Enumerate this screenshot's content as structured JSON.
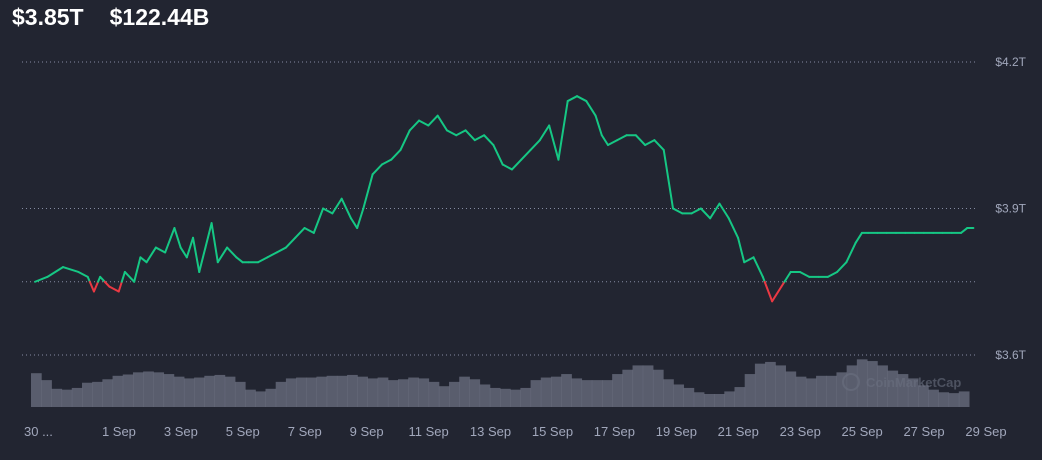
{
  "header": {
    "market_cap": "$3.85T",
    "volume": "$122.44B"
  },
  "watermark": "CoinMarketCap",
  "chart_data": {
    "type": "line",
    "title": "",
    "y_axis": {
      "position": "right",
      "ticks": [
        {
          "value": 3.6,
          "label": "$3.6T"
        },
        {
          "value": 3.9,
          "label": "$3.9T"
        },
        {
          "value": 4.2,
          "label": "$4.2T"
        }
      ],
      "ylim": [
        3.5,
        4.3
      ],
      "baseline": 3.75,
      "grid": "dotted"
    },
    "x_axis": {
      "xlim": [
        0,
        30.5
      ],
      "ticks": [
        {
          "value": 0,
          "label": "30 ..."
        },
        {
          "value": 2,
          "label": "1 Sep"
        },
        {
          "value": 4,
          "label": "3 Sep"
        },
        {
          "value": 6,
          "label": "5 Sep"
        },
        {
          "value": 8,
          "label": "7 Sep"
        },
        {
          "value": 10,
          "label": "9 Sep"
        },
        {
          "value": 12,
          "label": "11 Sep"
        },
        {
          "value": 14,
          "label": "13 Sep"
        },
        {
          "value": 16,
          "label": "15 Sep"
        },
        {
          "value": 18,
          "label": "17 Sep"
        },
        {
          "value": 20,
          "label": "19 Sep"
        },
        {
          "value": 22,
          "label": "21 Sep"
        },
        {
          "value": 24,
          "label": "23 Sep"
        },
        {
          "value": 26,
          "label": "25 Sep"
        },
        {
          "value": 28,
          "label": "27 Sep"
        },
        {
          "value": 30,
          "label": "29 Sep"
        }
      ]
    },
    "series": [
      {
        "values_x": [
          0.1,
          0.5,
          1.0,
          1.5,
          1.8,
          2.0,
          2.2,
          2.5,
          2.8,
          3.0,
          3.3,
          3.5,
          3.7,
          4.0,
          4.3,
          4.6,
          4.8,
          5.0,
          5.2,
          5.4,
          5.6,
          5.8,
          6.0,
          6.3,
          6.6,
          6.8,
          7.0,
          7.3,
          7.6,
          7.9,
          8.2,
          8.5,
          8.8,
          9.1,
          9.4,
          9.7,
          10.0,
          10.3,
          10.5,
          10.7,
          11.0,
          11.3,
          11.6,
          11.9,
          12.2,
          12.5,
          12.8,
          13.1,
          13.4,
          13.7,
          14.0,
          14.3,
          14.6,
          14.9,
          15.2,
          15.5,
          15.8,
          16.1,
          16.4,
          16.7,
          17.0,
          17.3,
          17.6,
          17.9,
          18.2,
          18.4,
          18.6,
          18.9,
          19.2,
          19.5,
          19.8,
          20.1,
          20.4,
          20.7,
          21.0,
          21.3,
          21.6,
          21.9,
          22.2,
          22.5,
          22.8,
          23.0,
          23.3,
          23.6,
          23.9,
          24.2,
          24.5,
          24.8,
          25.1,
          25.4,
          25.7,
          26.0,
          26.3,
          26.6,
          26.8,
          27.0,
          27.3,
          27.6,
          27.9,
          28.2,
          28.5,
          28.8,
          29.1,
          29.4,
          29.7,
          30.0,
          30.2,
          30.4
        ],
        "values_y": [
          3.75,
          3.76,
          3.78,
          3.77,
          3.76,
          3.73,
          3.76,
          3.74,
          3.73,
          3.77,
          3.75,
          3.8,
          3.79,
          3.82,
          3.81,
          3.86,
          3.82,
          3.8,
          3.84,
          3.77,
          3.82,
          3.87,
          3.79,
          3.82,
          3.8,
          3.79,
          3.79,
          3.79,
          3.8,
          3.81,
          3.82,
          3.84,
          3.86,
          3.85,
          3.9,
          3.89,
          3.92,
          3.88,
          3.86,
          3.9,
          3.97,
          3.99,
          4.0,
          4.02,
          4.06,
          4.08,
          4.07,
          4.09,
          4.06,
          4.05,
          4.06,
          4.04,
          4.05,
          4.03,
          3.99,
          3.98,
          4.0,
          4.02,
          4.04,
          4.07,
          4.0,
          4.12,
          4.13,
          4.12,
          4.09,
          4.05,
          4.03,
          4.04,
          4.05,
          4.05,
          4.03,
          4.04,
          4.02,
          3.9,
          3.89,
          3.89,
          3.9,
          3.88,
          3.91,
          3.88,
          3.84,
          3.79,
          3.8,
          3.76,
          3.71,
          3.74,
          3.77,
          3.77,
          3.76,
          3.76,
          3.76,
          3.77,
          3.79,
          3.83,
          3.85,
          3.85,
          3.85,
          3.85,
          3.85,
          3.85,
          3.85,
          3.85,
          3.85,
          3.85,
          3.85,
          3.85,
          3.86,
          3.86
        ]
      }
    ],
    "volume": {
      "values": [
        0.78,
        0.62,
        0.42,
        0.4,
        0.44,
        0.56,
        0.58,
        0.64,
        0.72,
        0.75,
        0.8,
        0.82,
        0.8,
        0.76,
        0.7,
        0.66,
        0.68,
        0.72,
        0.74,
        0.7,
        0.58,
        0.4,
        0.36,
        0.42,
        0.58,
        0.66,
        0.68,
        0.68,
        0.7,
        0.72,
        0.72,
        0.74,
        0.7,
        0.66,
        0.68,
        0.62,
        0.64,
        0.68,
        0.66,
        0.58,
        0.48,
        0.58,
        0.7,
        0.64,
        0.52,
        0.44,
        0.42,
        0.4,
        0.44,
        0.62,
        0.68,
        0.7,
        0.76,
        0.66,
        0.62,
        0.62,
        0.62,
        0.76,
        0.86,
        0.96,
        0.96,
        0.86,
        0.64,
        0.52,
        0.44,
        0.34,
        0.3,
        0.3,
        0.36,
        0.46,
        0.76,
        1.0,
        1.04,
        0.96,
        0.82,
        0.7,
        0.66,
        0.72,
        0.72,
        0.8,
        0.96,
        1.1,
        1.06,
        0.96,
        0.84,
        0.76,
        0.66,
        0.5,
        0.4,
        0.34,
        0.32,
        0.36
      ],
      "ylim": [
        0,
        1.2
      ]
    },
    "colors": {
      "up": "#16c784",
      "down": "#ea3943",
      "grid": "#858ca2",
      "volume": "#6c7082"
    },
    "grid": true,
    "legend": "none"
  }
}
